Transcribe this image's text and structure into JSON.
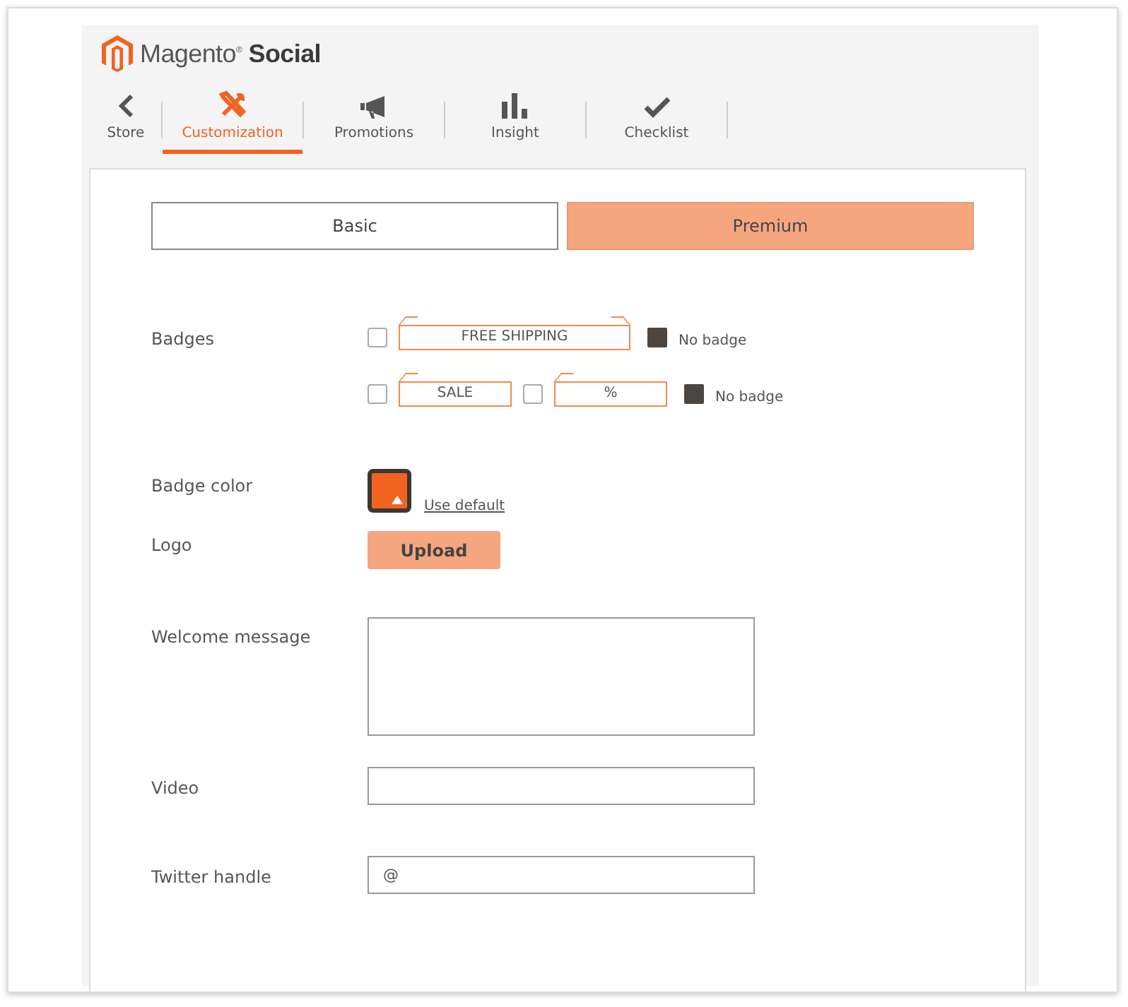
{
  "brand": {
    "text": "Magento$^{®}$ **Social**"
  },
  "tabs": [
    {
      "label": "Store",
      "kind": "back",
      "selected": false
    },
    {
      "label": "Customization",
      "kind": "tools",
      "selected": true
    },
    {
      "label": "Promotions",
      "kind": "megaphone",
      "selected": false
    },
    {
      "label": "Insight",
      "kind": "bars",
      "selected": false
    },
    {
      "label": "Checklist",
      "kind": "check",
      "selected": false
    }
  ],
  "plans": [
    {
      "label": "Basic",
      "selected": false
    },
    {
      "label": "Premium",
      "selected": true
    }
  ],
  "badges": {
    "label": "Badges",
    "rows": [
      {
        "options": [
          {
            "text": "FREE SHIPPING",
            "kind": "banner",
            "checked": false
          }
        ],
        "none": {
          "label": "No badge",
          "checked": true
        }
      },
      {
        "options": [
          {
            "text": "SALE",
            "kind": "tag",
            "checked": false
          },
          {
            "text": "%",
            "kind": "tag",
            "checked": false
          }
        ],
        "none": {
          "label": "No badge",
          "checked": true
        }
      }
    ]
  },
  "badge_color": {
    "label": "Badge color",
    "color": "#f26322",
    "link": "Use default"
  },
  "logo": {
    "label": "Logo",
    "button": "Upload"
  },
  "welcome": {
    "label": "Welcome message"
  },
  "video": {
    "label": "Video"
  },
  "twitter": {
    "label": "Twitter handle",
    "value": "@"
  }
}
